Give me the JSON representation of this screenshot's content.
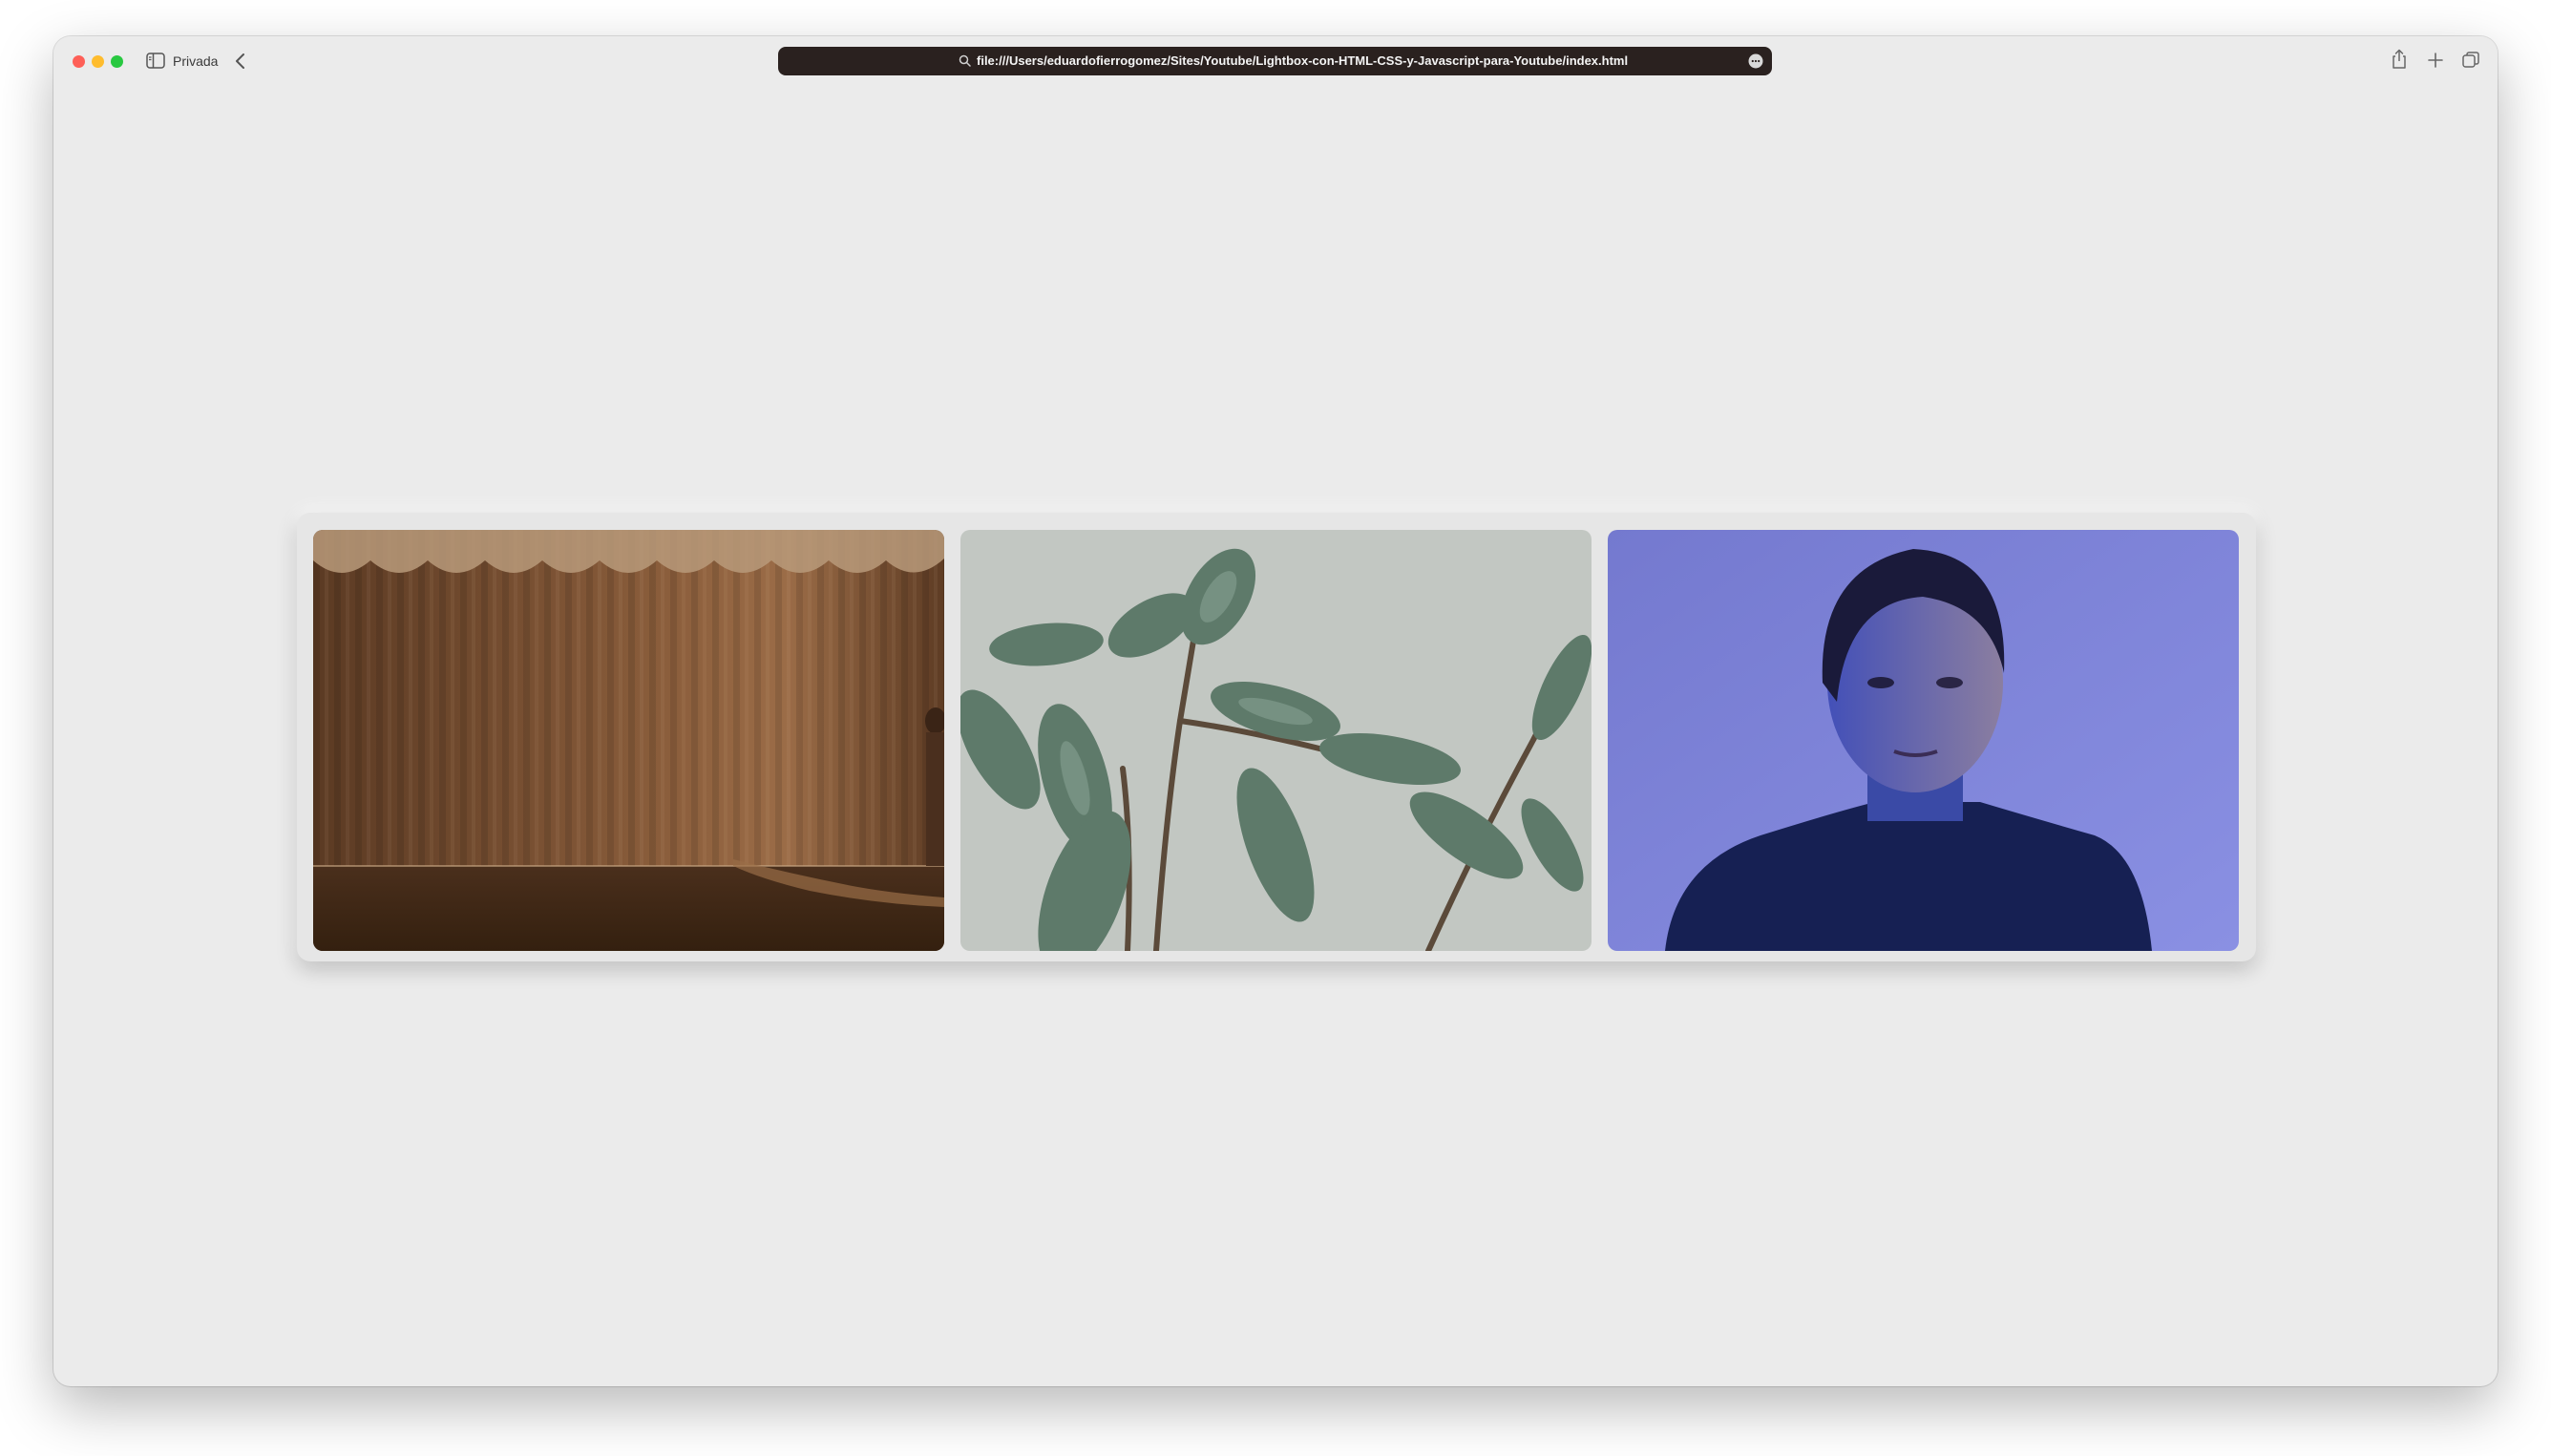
{
  "browser": {
    "private_label": "Privada",
    "url": "file:///Users/eduardofierrogomez/Sites/Youtube/Lightbox-con-HTML-CSS-y-Javascript-para-Youtube/index.html"
  },
  "gallery": {
    "photos": [
      {
        "subject": "stage-curtain-photo"
      },
      {
        "subject": "rubber-plant-photo"
      },
      {
        "subject": "woman-portrait-photo"
      }
    ]
  },
  "colors": {
    "window_bg": "#ebebeb",
    "url_bar_bg": "#2a211f",
    "curtain": "#7a5236",
    "plant_bg": "#c2c7c2",
    "portrait_bg": "#8088d8"
  }
}
